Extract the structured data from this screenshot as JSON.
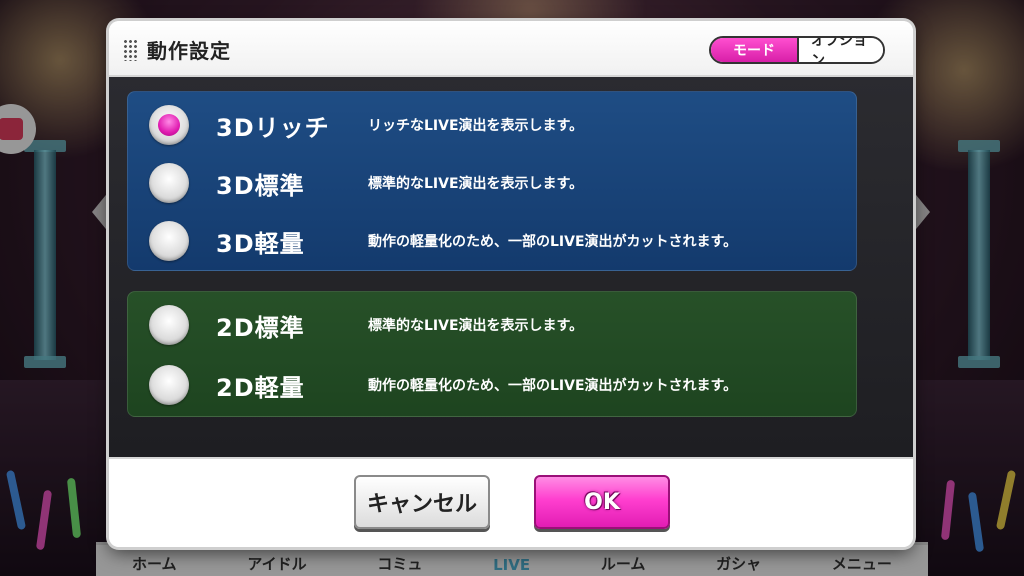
{
  "background": {
    "bottom_nav": [
      "ホーム",
      "アイドル",
      "コミュ",
      "LIVE",
      "ルーム",
      "ガシャ",
      "メニュー"
    ]
  },
  "dialog": {
    "title": "動作設定",
    "tabs": {
      "mode": "モード",
      "option": "オプション",
      "active": "mode"
    },
    "groups": [
      {
        "id": "3d",
        "options": [
          {
            "label": "3Dリッチ",
            "description": "リッチなLIVE演出を表示します。",
            "selected": true
          },
          {
            "label": "3D標準",
            "description": "標準的なLIVE演出を表示します。",
            "selected": false
          },
          {
            "label": "3D軽量",
            "description": "動作の軽量化のため、一部のLIVE演出がカットされます。",
            "selected": false
          }
        ]
      },
      {
        "id": "2d",
        "options": [
          {
            "label": "2D標準",
            "description": "標準的なLIVE演出を表示します。",
            "selected": false
          },
          {
            "label": "2D軽量",
            "description": "動作の軽量化のため、一部のLIVE演出がカットされます。",
            "selected": false
          }
        ]
      }
    ],
    "buttons": {
      "cancel": "キャンセル",
      "ok": "OK"
    }
  },
  "colors": {
    "accent": "#e21db4",
    "group_3d": "#1e508c",
    "group_2d": "#285528"
  }
}
